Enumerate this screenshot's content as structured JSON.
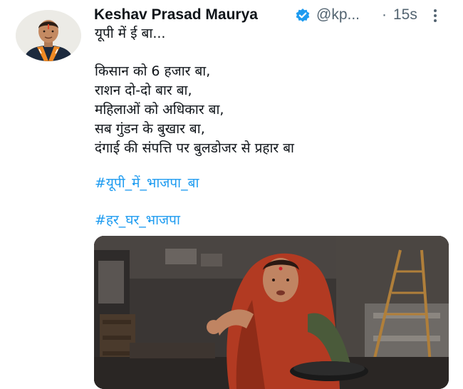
{
  "tweet": {
    "display_name": "Keshav Prasad Maurya",
    "handle": "@kp...",
    "separator": "·",
    "timestamp": "15s",
    "more_icon": "more-vertical-icon",
    "verified_icon": "verified-badge-icon",
    "lines": [
      "यूपी में ई बा...",
      "किसान को 6 हजार बा,",
      "राशन दो-दो बार बा,",
      "महिलाओं को अधिकार बा,",
      "सब गुंडन के बुखार बा,",
      "दंगाई की संपत्ति पर बुलडोजर से प्रहार बा"
    ],
    "hashtags": [
      "#यूपी_में_भाजपा_बा",
      "#हर_घर_भाजपा"
    ],
    "colors": {
      "text": "#0f1419",
      "secondary": "#536471",
      "link": "#1d9bf0",
      "verified": "#1d9bf0"
    }
  }
}
